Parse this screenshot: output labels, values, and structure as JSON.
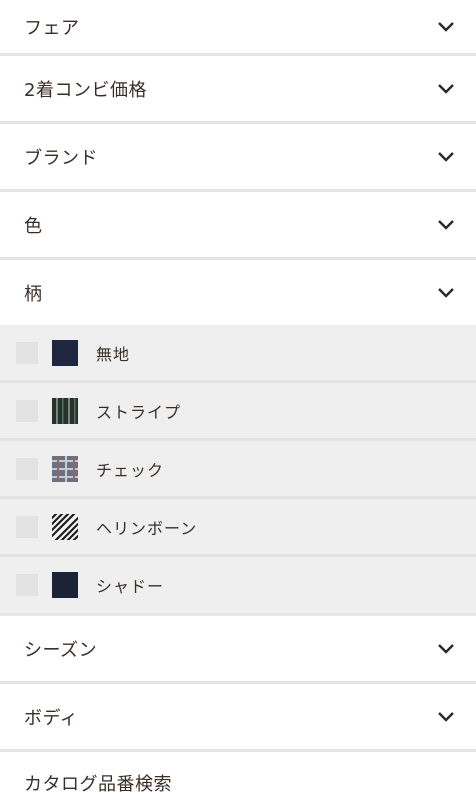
{
  "sections": [
    {
      "label": "フェア"
    },
    {
      "label": "2着コンビ価格"
    },
    {
      "label": "ブランド"
    },
    {
      "label": "色"
    },
    {
      "label": "柄"
    },
    {
      "label": "シーズン"
    },
    {
      "label": "ボディ"
    },
    {
      "label": "カタログ品番検索"
    }
  ],
  "pattern_options": [
    {
      "label": "無地",
      "checked": false,
      "swatch_icon": "solid-swatch-icon"
    },
    {
      "label": "ストライプ",
      "checked": false,
      "swatch_icon": "stripe-swatch-icon"
    },
    {
      "label": "チェック",
      "checked": false,
      "swatch_icon": "check-swatch-icon"
    },
    {
      "label": "ヘリンボーン",
      "checked": false,
      "swatch_icon": "herringbone-swatch-icon"
    },
    {
      "label": "シャドー",
      "checked": false,
      "swatch_icon": "shadow-swatch-icon"
    }
  ],
  "colors": {
    "text": "#3a2e27",
    "divider": "#e5e5e5",
    "panel_bg": "#efefef",
    "swatch_navy": "#1f2740"
  }
}
